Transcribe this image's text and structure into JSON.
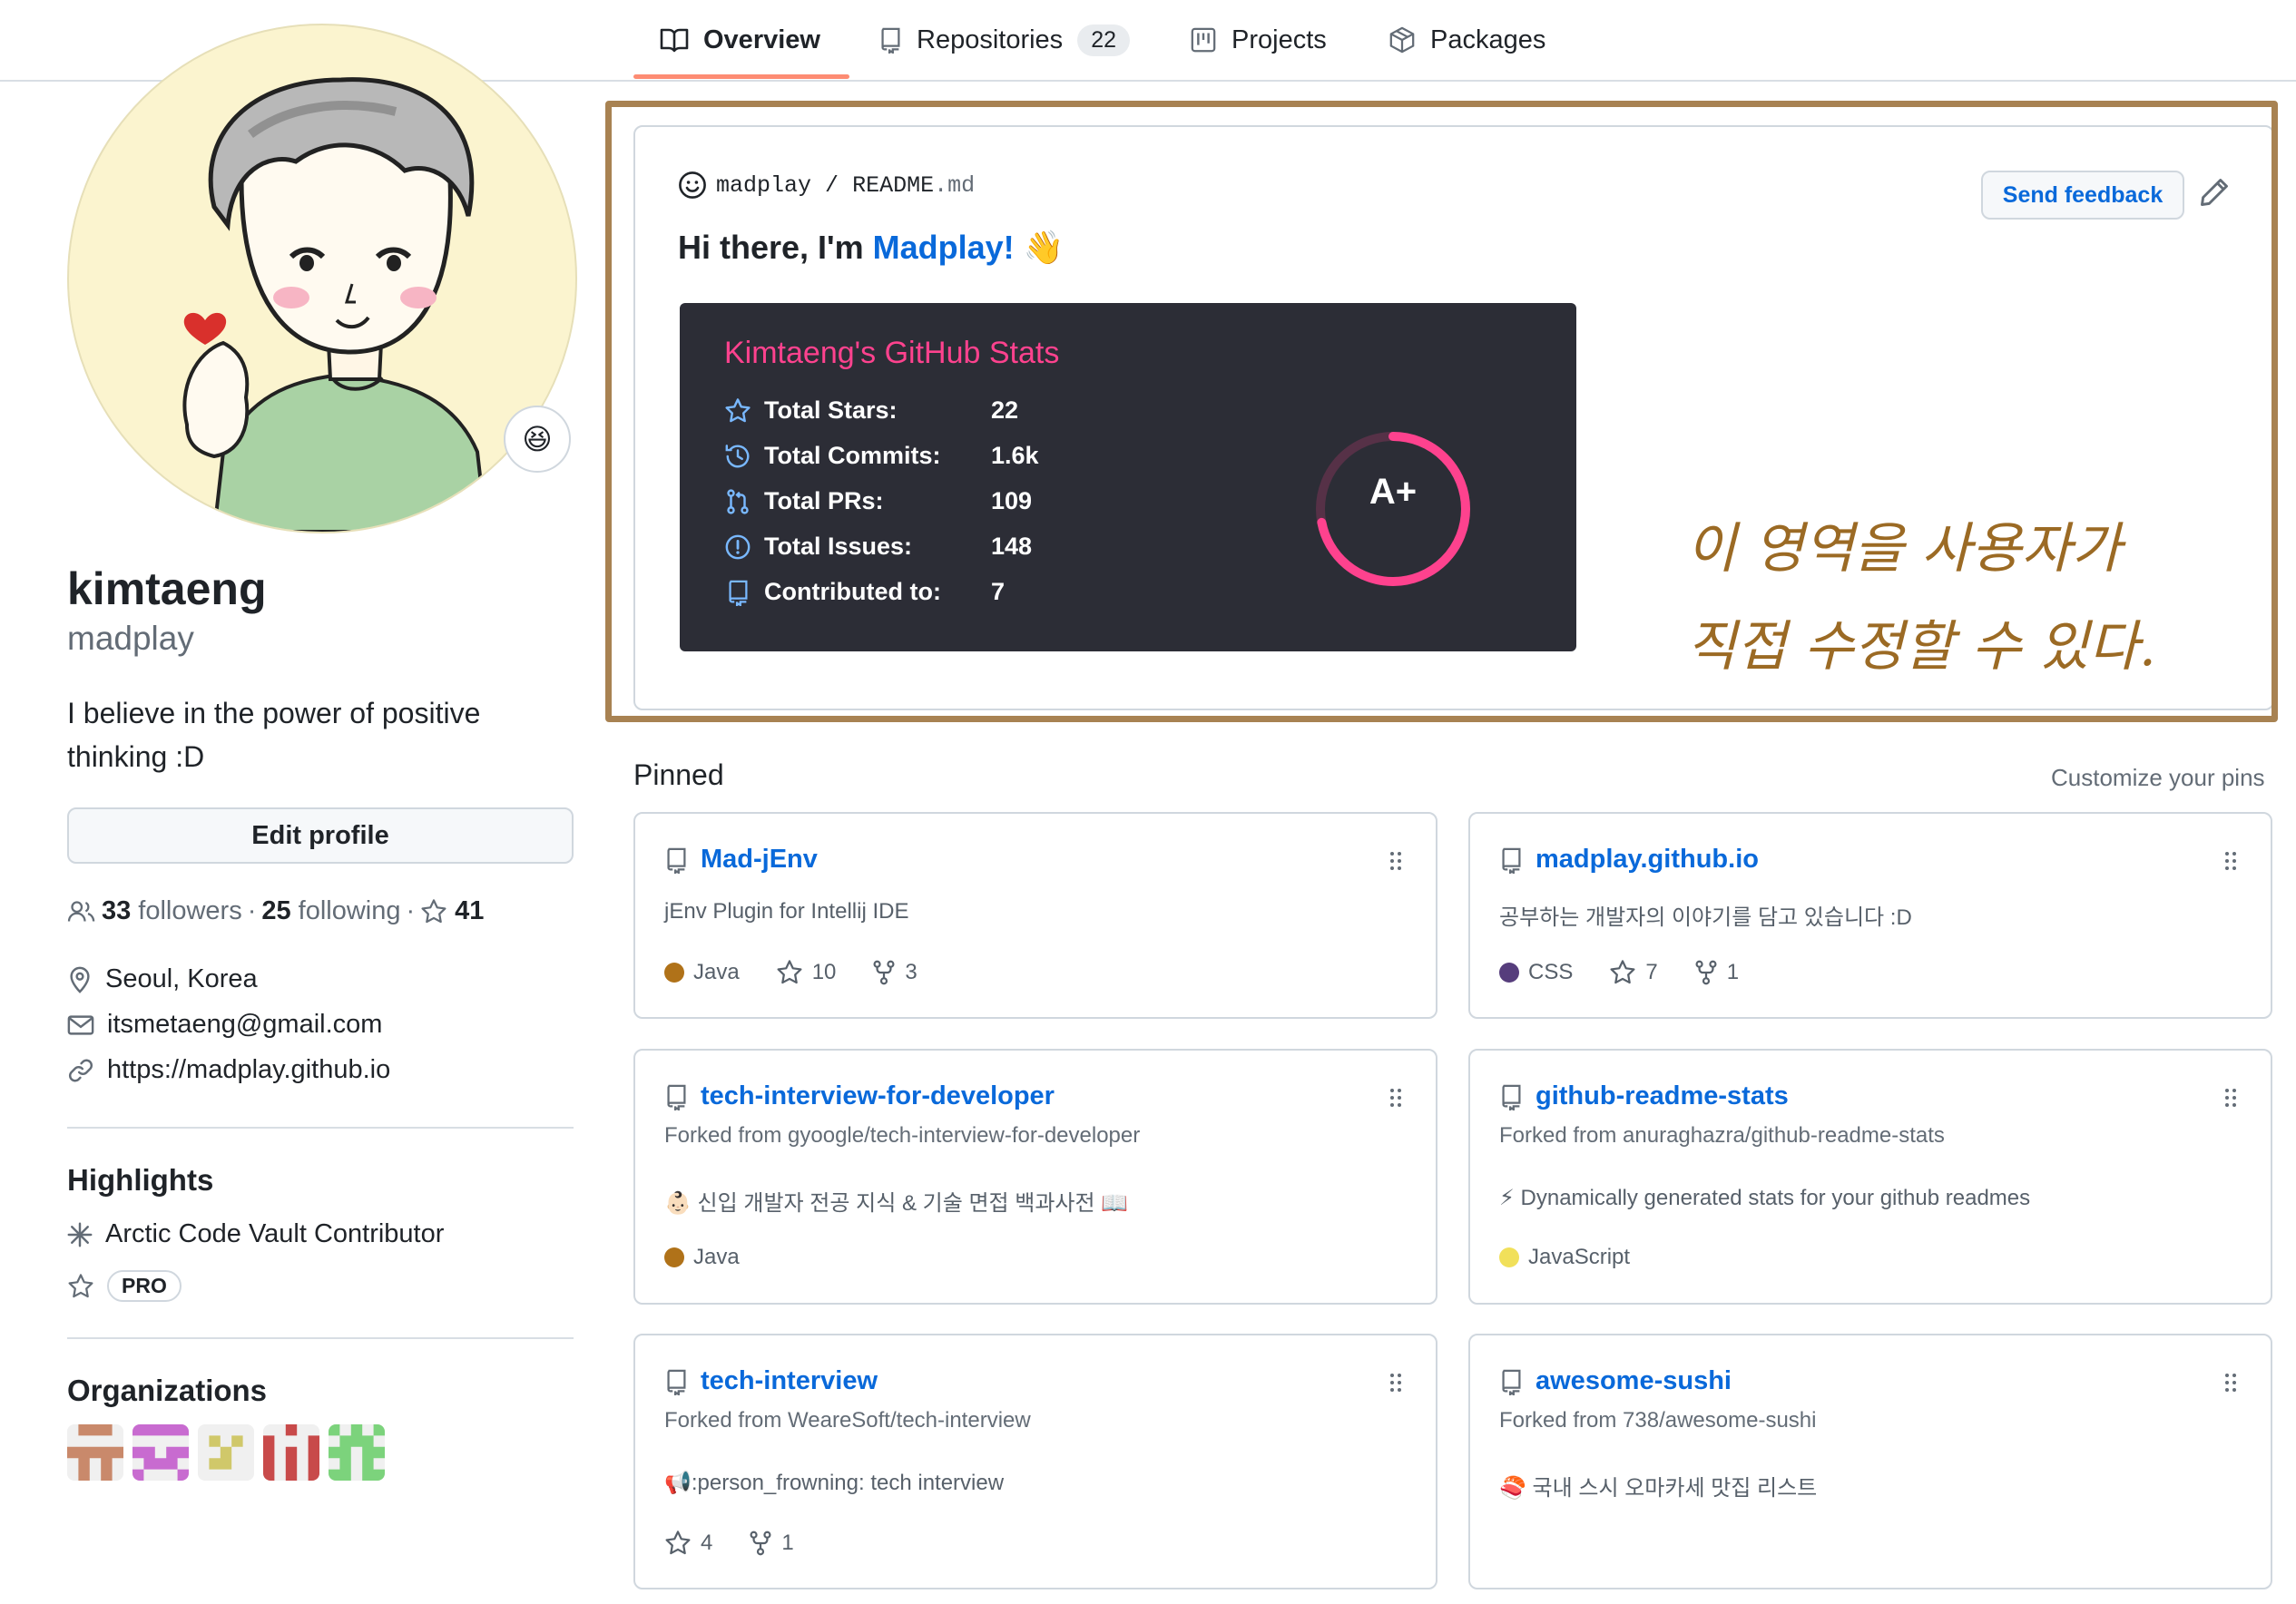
{
  "tabs": [
    {
      "label": "Overview",
      "icon": "book-icon",
      "active": true
    },
    {
      "label": "Repositories",
      "icon": "repo-icon",
      "count": "22"
    },
    {
      "label": "Projects",
      "icon": "project-icon"
    },
    {
      "label": "Packages",
      "icon": "package-icon"
    }
  ],
  "profile": {
    "status_emoji": "😆",
    "display_name": "kimtaeng",
    "username": "madplay",
    "bio": "I believe in the power of positive thinking :D",
    "edit_label": "Edit profile",
    "followers_count": "33",
    "followers_label": "followers",
    "sep1": "·",
    "following_count": "25",
    "following_label": "following",
    "sep2": "·",
    "stars_count": "41",
    "location": "Seoul, Korea",
    "email": "itsmetaeng@gmail.com",
    "website": "https://madplay.github.io"
  },
  "highlights": {
    "title": "Highlights",
    "items": [
      "Arctic Code Vault Contributor"
    ],
    "pro_label": "PRO"
  },
  "organizations": {
    "title": "Organizations",
    "count": 5
  },
  "readme": {
    "owner": "madplay",
    "slash": "/",
    "file_base": "README",
    "file_ext": ".md",
    "feedback_label": "Send feedback",
    "greeting_prefix": "Hi there, I'm ",
    "greeting_name": "Madplay!",
    "greeting_emoji": "👋"
  },
  "stats": {
    "title": "Kimtaeng's GitHub Stats",
    "rows": [
      {
        "icon": "star-icon",
        "label": "Total Stars:",
        "value": "22"
      },
      {
        "icon": "history-icon",
        "label": "Total Commits:",
        "value": "1.6k"
      },
      {
        "icon": "pull-request-icon",
        "label": "Total PRs:",
        "value": "109"
      },
      {
        "icon": "issue-icon",
        "label": "Total Issues:",
        "value": "148"
      },
      {
        "icon": "repo-icon",
        "label": "Contributed to:",
        "value": "7"
      }
    ],
    "grade": "A+",
    "grade_progress": 0.72,
    "colors": {
      "title": "#fe428e",
      "icon": "#79b8ff",
      "ring": "#fe428e",
      "bg": "#2c2d36"
    }
  },
  "annotation": {
    "line1": "이 영역을 사용자가",
    "line2": "직접 수정할 수 있다."
  },
  "pinned": {
    "title": "Pinned",
    "customize_label": "Customize your pins",
    "items": [
      {
        "name": "Mad-jEnv",
        "forked_from": "",
        "description": "jEnv Plugin for Intellij IDE",
        "language": "Java",
        "lang_color": "#b07219",
        "stars": "10",
        "forks": "3"
      },
      {
        "name": "madplay.github.io",
        "forked_from": "",
        "description": "공부하는 개발자의 이야기를 담고 있습니다 :D",
        "language": "CSS",
        "lang_color": "#563d7c",
        "stars": "7",
        "forks": "1"
      },
      {
        "name": "tech-interview-for-developer",
        "forked_from": "Forked from gyoogle/tech-interview-for-developer",
        "description": "👶🏻 신입 개발자 전공 지식 & 기술 면접 백과사전 📖",
        "language": "Java",
        "lang_color": "#b07219",
        "stars": "",
        "forks": ""
      },
      {
        "name": "github-readme-stats",
        "forked_from": "Forked from anuraghazra/github-readme-stats",
        "description": "⚡ Dynamically generated stats for your github readmes",
        "language": "JavaScript",
        "lang_color": "#f1e05a",
        "stars": "",
        "forks": ""
      },
      {
        "name": "tech-interview",
        "forked_from": "Forked from WeareSoft/tech-interview",
        "description": "📢:person_frowning: tech interview",
        "language": "",
        "lang_color": "",
        "stars": "4",
        "forks": "1"
      },
      {
        "name": "awesome-sushi",
        "forked_from": "Forked from 738/awesome-sushi",
        "description": "🍣 국내 스시 오마카세 맛집 리스트",
        "language": "",
        "lang_color": "",
        "stars": "",
        "forks": ""
      }
    ]
  }
}
